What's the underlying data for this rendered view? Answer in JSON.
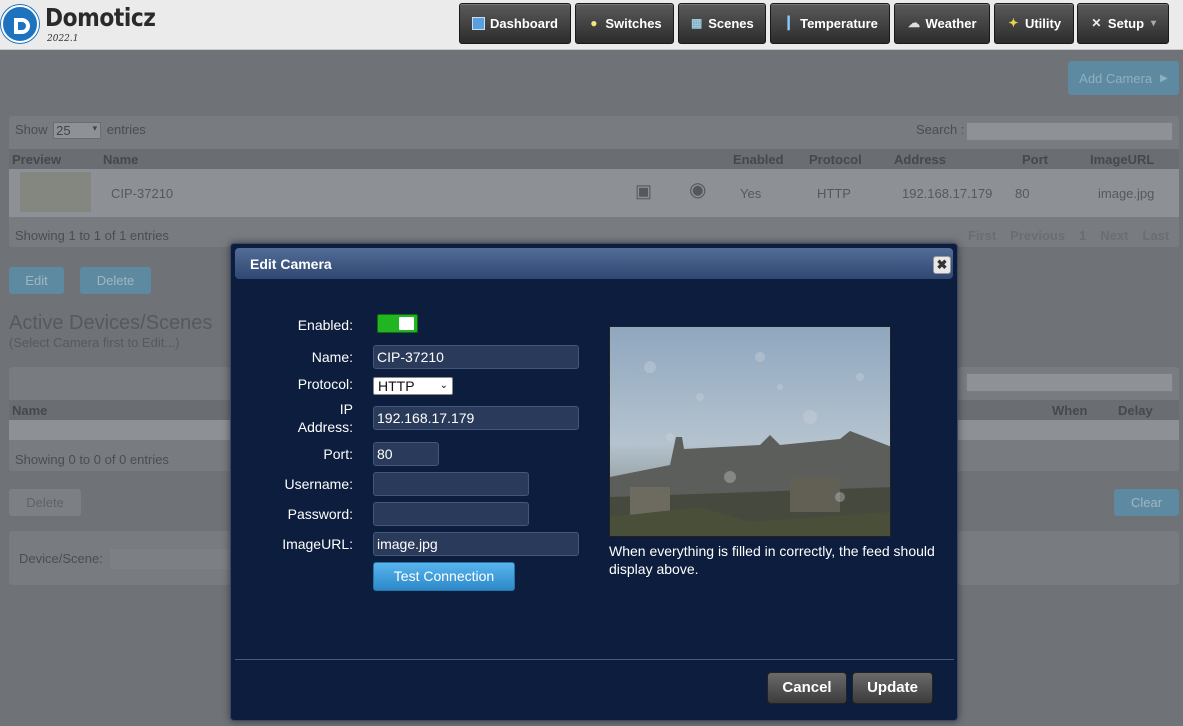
{
  "app": {
    "name": "Domoticz",
    "version": "2022.1"
  },
  "nav": [
    {
      "label": "Dashboard",
      "icon": "dashboard-icon"
    },
    {
      "label": "Switches",
      "icon": "lightbulb-icon"
    },
    {
      "label": "Scenes",
      "icon": "clapperboard-icon"
    },
    {
      "label": "Temperature",
      "icon": "thermometer-icon"
    },
    {
      "label": "Weather",
      "icon": "cloud-rain-icon"
    },
    {
      "label": "Utility",
      "icon": "utility-icon"
    },
    {
      "label": "Setup",
      "icon": "tools-icon",
      "caret": "▾"
    }
  ],
  "camera_page": {
    "add_camera_label": "Add Camera",
    "show_label": "Show",
    "entries_select": "25",
    "entries_label": "entries",
    "search_label": "Search :",
    "columns": [
      "Preview",
      "Name",
      "Enabled",
      "Protocol",
      "Address",
      "Port",
      "ImageURL"
    ],
    "rows": [
      {
        "name": "CIP-37210",
        "enabled": "Yes",
        "protocol": "HTTP",
        "address": "192.168.17.179",
        "port": "80",
        "imageurl": "image.jpg"
      }
    ],
    "info": "Showing 1 to 1 of 1 entries",
    "pager": [
      "First",
      "Previous",
      "1",
      "Next",
      "Last"
    ],
    "edit_label": "Edit",
    "delete_label": "Delete"
  },
  "devices_section": {
    "title": "Active Devices/Scenes",
    "subtitle": "(Select Camera first to Edit...)",
    "columns": [
      "Name",
      "When",
      "Delay"
    ],
    "info": "Showing 0 to 0 of 0 entries",
    "delete_label": "Delete",
    "clear_label": "Clear",
    "device_scene_label": "Device/Scene:"
  },
  "dialog": {
    "title": "Edit Camera",
    "close_label": "✖",
    "fields": {
      "enabled_label": "Enabled:",
      "enabled_value": true,
      "name_label": "Name:",
      "name_value": "CIP-37210",
      "protocol_label": "Protocol:",
      "protocol_value": "HTTP",
      "ip_label_1": "IP",
      "ip_label_2": "Address:",
      "ip_value": "192.168.17.179",
      "port_label": "Port:",
      "port_value": "80",
      "username_label": "Username:",
      "username_value": "",
      "password_label": "Password:",
      "password_value": "",
      "imageurl_label": "ImageURL:",
      "imageurl_value": "image.jpg"
    },
    "test_label": "Test Connection",
    "note": "When everything is filled in correctly, the feed should display above.",
    "cancel_label": "Cancel",
    "update_label": "Update"
  }
}
